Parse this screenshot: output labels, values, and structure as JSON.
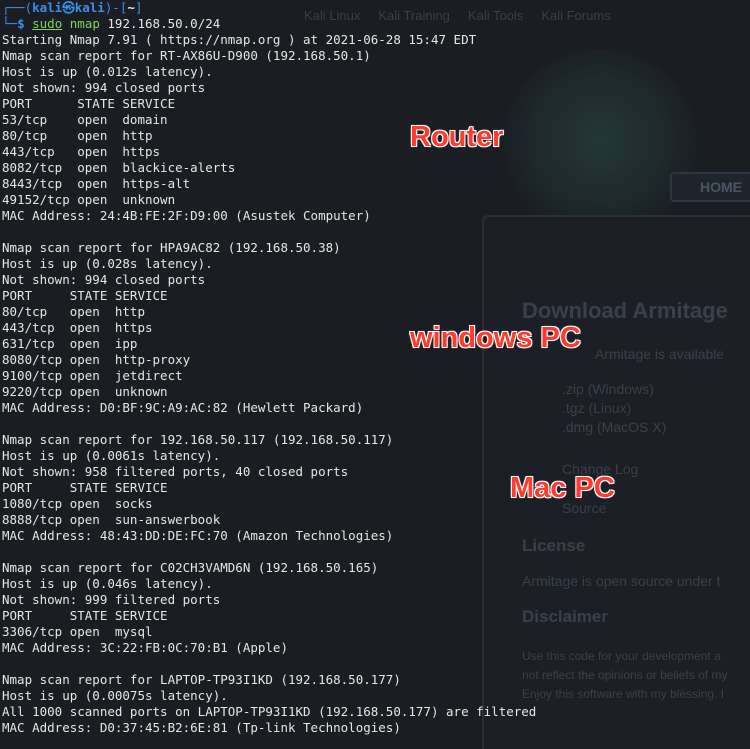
{
  "background_page": {
    "nav": [
      "Kali Linux",
      "Kali Training",
      "Kali Tools",
      "Kali Forums"
    ],
    "home_button": "HOME",
    "download_heading": "Download Armitage",
    "availability_text": "Armitage is available",
    "links": [
      ".zip (Windows)",
      ".tgz (Linux)",
      ".dmg (MacOS X)"
    ],
    "changelog": "Change Log",
    "source": "Source",
    "license_heading": "License",
    "license_text": "Armitage is open source under t",
    "disclaimer_heading": "Disclaimer",
    "disclaimer_lines": [
      "Use this code for your development a",
      "not reflect the opinions or beliefs of my",
      "Enjoy this software with my blessing. I"
    ]
  },
  "prompt": {
    "user_host": "kali㉿kali",
    "cwd": "~",
    "sudo": "sudo",
    "nmap": "nmap",
    "args": " 192.168.50.0/24"
  },
  "output_lines": [
    "Starting Nmap 7.91 ( https://nmap.org ) at 2021-06-28 15:47 EDT",
    "Nmap scan report for RT-AX86U-D900 (192.168.50.1)",
    "Host is up (0.012s latency).",
    "Not shown: 994 closed ports",
    "PORT      STATE SERVICE",
    "53/tcp    open  domain",
    "80/tcp    open  http",
    "443/tcp   open  https",
    "8082/tcp  open  blackice-alerts",
    "8443/tcp  open  https-alt",
    "49152/tcp open  unknown",
    "MAC Address: 24:4B:FE:2F:D9:00 (Asustek Computer)",
    "",
    "Nmap scan report for HPA9AC82 (192.168.50.38)",
    "Host is up (0.028s latency).",
    "Not shown: 994 closed ports",
    "PORT     STATE SERVICE",
    "80/tcp   open  http",
    "443/tcp  open  https",
    "631/tcp  open  ipp",
    "8080/tcp open  http-proxy",
    "9100/tcp open  jetdirect",
    "9220/tcp open  unknown",
    "MAC Address: D0:BF:9C:A9:AC:82 (Hewlett Packard)",
    "",
    "Nmap scan report for 192.168.50.117 (192.168.50.117)",
    "Host is up (0.0061s latency).",
    "Not shown: 958 filtered ports, 40 closed ports",
    "PORT     STATE SERVICE",
    "1080/tcp open  socks",
    "8888/tcp open  sun-answerbook",
    "MAC Address: 48:43:DD:DE:FC:70 (Amazon Technologies)",
    "",
    "Nmap scan report for C02CH3VAMD6N (192.168.50.165)",
    "Host is up (0.046s latency).",
    "Not shown: 999 filtered ports",
    "PORT     STATE SERVICE",
    "3306/tcp open  mysql",
    "MAC Address: 3C:22:FB:0C:70:B1 (Apple)",
    "",
    "Nmap scan report for LAPTOP-TP93I1KD (192.168.50.177)",
    "Host is up (0.00075s latency).",
    "All 1000 scanned ports on LAPTOP-TP93I1KD (192.168.50.177) are filtered",
    "MAC Address: D0:37:45:B2:6E:81 (Tp-link Technologies)"
  ],
  "annotations": {
    "router": "Router",
    "windows": "windows PC",
    "mac": "Mac PC"
  },
  "colors": {
    "prompt_blue": "#3b8eea",
    "command_green": "#7fd35f",
    "annotation_red": "#ff3b2f"
  }
}
